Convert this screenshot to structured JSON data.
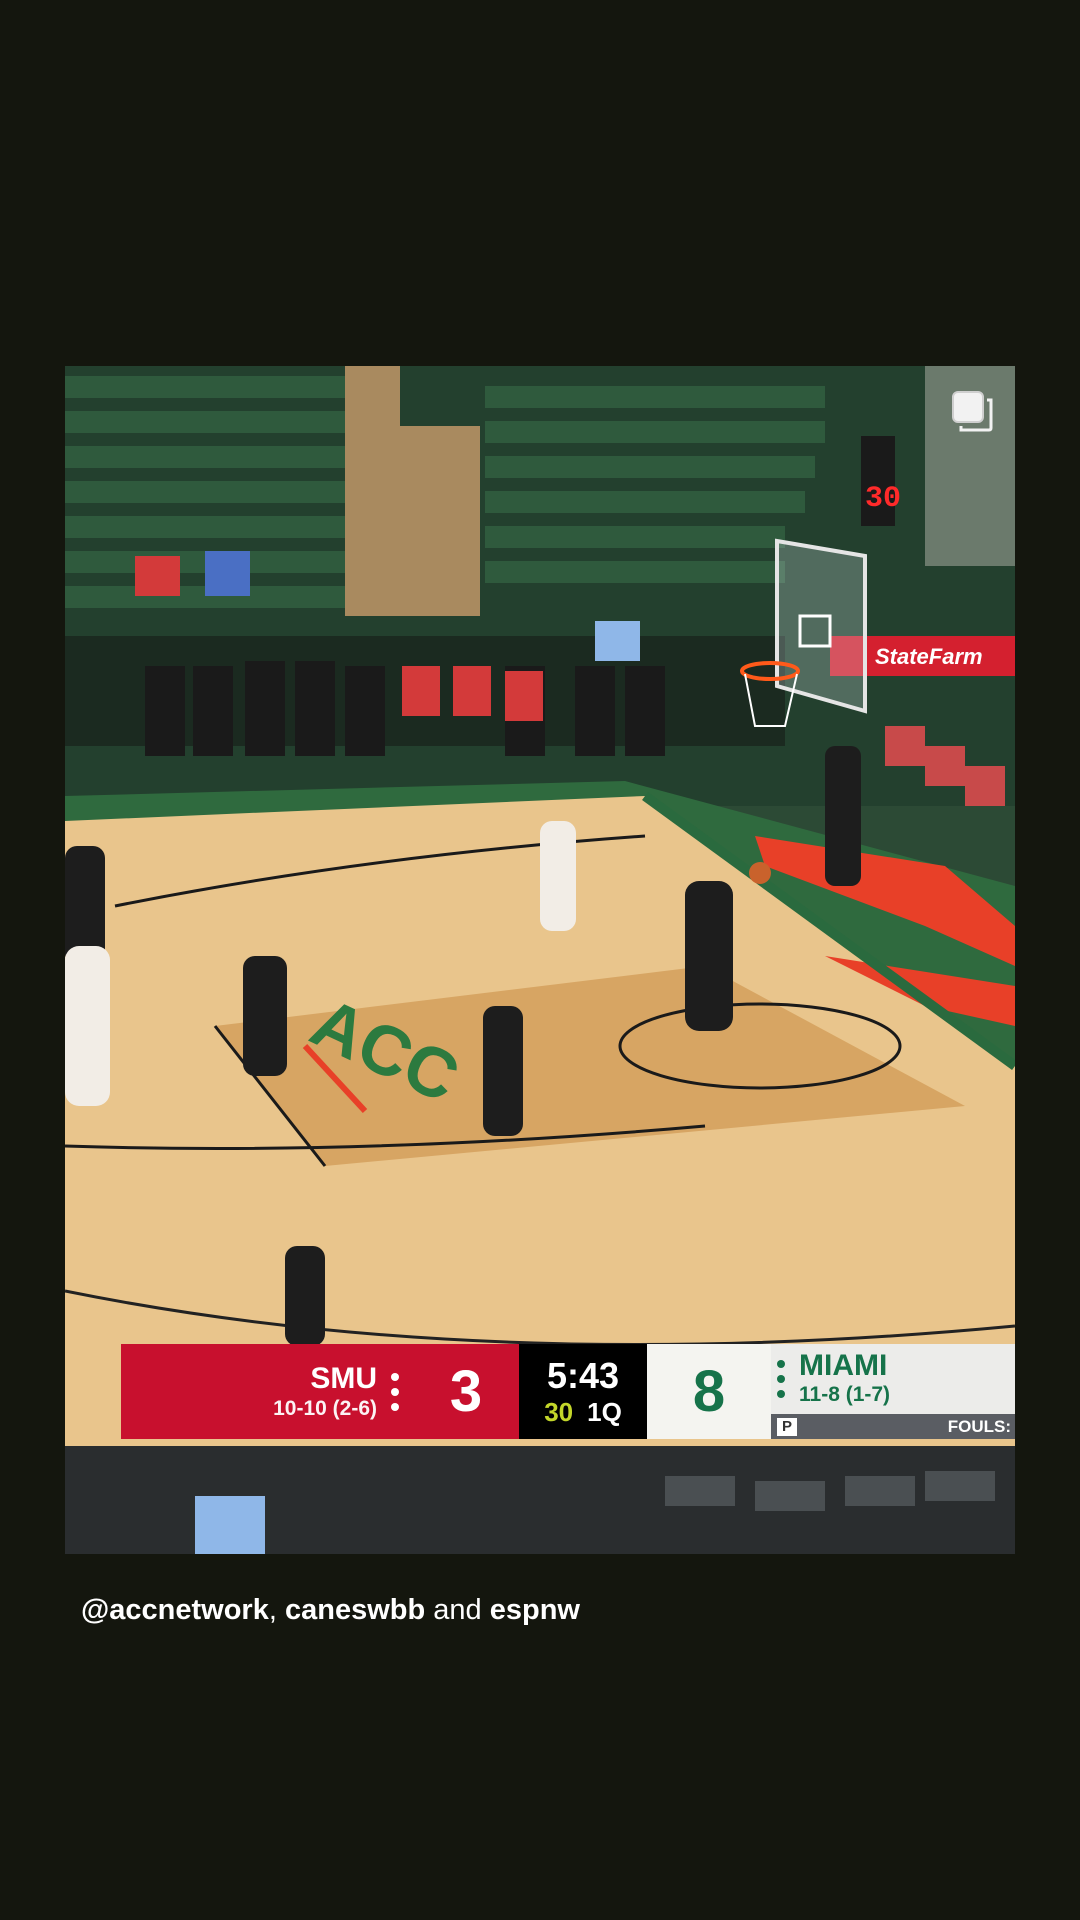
{
  "scorebug": {
    "away_name": "SMU",
    "away_record": "10-10 (2-6)",
    "away_score": "3",
    "clock": "5:43",
    "shot_clock": "30",
    "period": "1Q",
    "home_score": "8",
    "home_name": "MIAMI",
    "home_record": "11-8 (1-7)",
    "possession": "P",
    "fouls_label": "FOULS:"
  },
  "arena": {
    "court_logo": "ACC",
    "sponsor": "StateFarm",
    "shot_clock_display": "30"
  },
  "caption": {
    "account_1": "@accnetwork",
    "separator_1": ",",
    "account_2": "caneswbb",
    "separator_2": "and",
    "account_3": "espnw"
  },
  "icons": {
    "multi_post": "multiple-images-icon"
  },
  "colors": {
    "background": "#14160e",
    "smu_red": "#c8102e",
    "miami_green": "#16734a",
    "shot_clock_yellow": "#c3d62a"
  }
}
